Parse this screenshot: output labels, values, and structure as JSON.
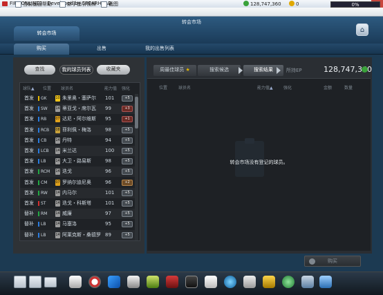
{
  "titlebar": {
    "title": "FIFA ONLINE3 - Developed by SPEARHEAD",
    "min": "–",
    "max": "□",
    "close": "✕"
  },
  "topbar": {
    "links": [
      "当前画面帮助",
      "新手指引视频",
      "截图"
    ],
    "money": "128,747,360",
    "cash": "0",
    "progress": "0%"
  },
  "header": {
    "title": "转会市场",
    "market_tab": "转会市场"
  },
  "subnav": {
    "tabs": [
      "购买",
      "出售",
      "我的出售列表"
    ]
  },
  "left": {
    "search_button": "查找",
    "list_button": "我的球员列表",
    "fav_button": "收藏夹",
    "columns": [
      "球队",
      "位置",
      "球员名",
      "能力值",
      "强化"
    ],
    "sort_mark": "▲",
    "rows": [
      {
        "team": "首发",
        "pos": "GK",
        "num": "10",
        "name": "朱里奥・塞萨尔",
        "ovr": "101",
        "tag": "+5",
        "color": "#e6b800",
        "tagstyle": "normal"
      },
      {
        "team": "首发",
        "pos": "SW",
        "num": "14",
        "name": "蒂亚戈・席尔瓦",
        "ovr": "99",
        "tag": "+3",
        "color": "#2a7de1",
        "tagstyle": "red"
      },
      {
        "team": "首发",
        "pos": "RB",
        "num": "07",
        "name": "达尼・阿尔维斯",
        "ovr": "95",
        "tag": "+1",
        "color": "#2a7de1",
        "tagstyle": "red"
      },
      {
        "team": "首发",
        "pos": "RCB",
        "num": "08",
        "name": "菲利佩・梅洛",
        "ovr": "98",
        "tag": "+5",
        "color": "#2a7de1",
        "tagstyle": "normal"
      },
      {
        "team": "首发",
        "pos": "CB",
        "num": "14",
        "name": "丹特",
        "ovr": "94",
        "tag": "+5",
        "color": "#2a7de1",
        "tagstyle": "normal"
      },
      {
        "team": "首发",
        "pos": "LCB",
        "num": "14",
        "name": "米兰达",
        "ovr": "100",
        "tag": "+5",
        "color": "#2a7de1",
        "tagstyle": "normal"
      },
      {
        "team": "首发",
        "pos": "LB",
        "num": "14",
        "name": "大卫・路易斯",
        "ovr": "98",
        "tag": "+5",
        "color": "#2a7de1",
        "tagstyle": "normal"
      },
      {
        "team": "首发",
        "pos": "RCM",
        "num": "14",
        "name": "迭戈",
        "ovr": "96",
        "tag": "+5",
        "color": "#22aa44",
        "tagstyle": "normal"
      },
      {
        "team": "首发",
        "pos": "CM",
        "num": "07",
        "name": "罗纳尔迪尼奥",
        "ovr": "96",
        "tag": "+2",
        "color": "#22aa44",
        "tagstyle": "org"
      },
      {
        "team": "首发",
        "pos": "RW",
        "num": "14",
        "name": "内马尔",
        "ovr": "101",
        "tag": "+5",
        "color": "#22aa44",
        "tagstyle": "normal"
      },
      {
        "team": "首发",
        "pos": "ST",
        "num": "14",
        "name": "迭戈・科斯塔",
        "ovr": "101",
        "tag": "+5",
        "color": "#d62f2f",
        "tagstyle": "normal"
      },
      {
        "team": "替补",
        "pos": "RM",
        "num": "14",
        "name": "威廉",
        "ovr": "97",
        "tag": "+5",
        "color": "#22aa44",
        "tagstyle": "normal"
      },
      {
        "team": "替补",
        "pos": "LB",
        "num": "14",
        "name": "马塞洛",
        "ovr": "95",
        "tag": "+5",
        "color": "#2a7de1",
        "tagstyle": "normal"
      },
      {
        "team": "替补",
        "pos": "LB",
        "num": "14",
        "name": "阿莱克斯・桑德罗",
        "ovr": "89",
        "tag": "+5",
        "color": "#2a7de1",
        "tagstyle": "normal"
      }
    ]
  },
  "right": {
    "tabs": [
      "周最佳球员",
      "搜索候选",
      "搜索结果"
    ],
    "ep_label": "所持EP",
    "total": "128,747,360",
    "columns": [
      "位置",
      "球员名",
      "能力值",
      "强化",
      "金额",
      "数量"
    ],
    "sort_mark": "▲",
    "empty_message": "转会市场没有登记的球员。",
    "buy_button": "购买"
  }
}
